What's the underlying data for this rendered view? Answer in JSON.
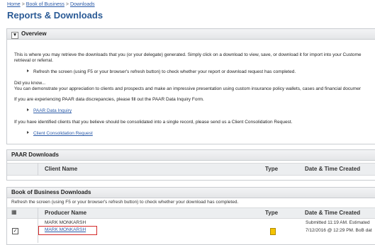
{
  "breadcrumb": {
    "home": "Home",
    "sep1": ">",
    "book": "Book of Business",
    "sep2": ">",
    "current": "Downloads"
  },
  "page": {
    "title": "Reports & Downloads"
  },
  "overview": {
    "header": "Overview",
    "line1": "This is where you may retrieve the downloads that you (or your delegate) generated. Simply click on a download to view, save, or download it for import into your Custome",
    "line2": "retrieval or referral.",
    "bullet1": "Refresh the screen (using F5 or your browser's refresh button) to check whether your report or download request has completed.",
    "did_you_know": "Did you know...",
    "line3": "You can demonstrate your appreciation to clients and prospects and make an impressive presentation using custom insurance policy wallets, cases and financial documer",
    "line4": "If you are experiencing PAAR data discrepancies, please fill out the PAAR Data Inquiry Form.",
    "link1": "PAAR Data Inquiry",
    "line5": "If you have identified clients that you believe should be consolidated into a single record, please send us a Client Consolidation Request.",
    "link2": "Client Consolidation Request"
  },
  "paar": {
    "header": "PAAR Downloads",
    "col_client": "Client Name",
    "col_type": "Type",
    "col_date": "Date & Time Created"
  },
  "bob": {
    "header": "Book of Business Downloads",
    "note": "Refresh the screen (using F5 or your browser's refresh button) to check whether your download has completed.",
    "col_producer": "Producer Name",
    "col_type": "Type",
    "col_date": "Date & Time Created",
    "rows": [
      {
        "producer": "MARK MONKARSH",
        "date": "Submitted 11:19 AM. Estimated "
      },
      {
        "producer": "MARK MONKARSH",
        "date": "7/12/2016 @ 12:29 PM. BoB dat"
      }
    ]
  }
}
